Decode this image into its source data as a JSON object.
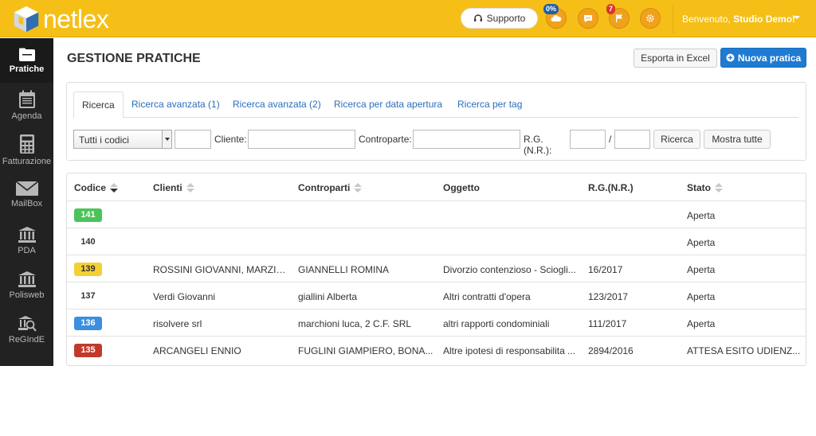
{
  "app": {
    "logo_text": "netlex"
  },
  "header": {
    "support_label": "Supporto",
    "cloud_badge": "0%",
    "notify_badge": "7",
    "welcome_prefix": "Benvenuto, ",
    "welcome_user": "Studio Demo!"
  },
  "sidebar": {
    "items": [
      {
        "label": "Pratiche",
        "icon": "folder-icon"
      },
      {
        "label": "Agenda",
        "icon": "calendar-icon"
      },
      {
        "label": "Fatturazione",
        "icon": "calculator-icon"
      },
      {
        "label": "MailBox",
        "icon": "envelope-icon"
      },
      {
        "label": "PDA",
        "icon": "courthouse-icon"
      },
      {
        "label": "Polisweb",
        "icon": "courthouse-icon"
      },
      {
        "label": "ReGIndE",
        "icon": "registry-icon"
      }
    ]
  },
  "main": {
    "title": "GESTIONE PRATICHE",
    "export_label": "Esporta in Excel",
    "new_label": "Nuova pratica"
  },
  "search": {
    "tabs": [
      "Ricerca",
      "Ricerca avanzata (1)",
      "Ricerca avanzata (2)",
      "Ricerca per data apertura",
      "Ricerca per tag"
    ],
    "select_value": "Tutti i codici",
    "cliente_label": "Cliente:",
    "controparte_label": "Controparte:",
    "rg_label": "R.G.(N.R.):",
    "slash": "/",
    "search_button": "Ricerca",
    "show_all_button": "Mostra tutte"
  },
  "table": {
    "columns": [
      "Codice",
      "Clienti",
      "Controparti",
      "Oggetto",
      "R.G.(N.R.)",
      "Stato"
    ],
    "rows": [
      {
        "code": "141",
        "color": "#4cc35a",
        "clienti": "",
        "controparti": "",
        "oggetto": "",
        "rg": "",
        "stato": "Aperta"
      },
      {
        "code": "140",
        "color": "",
        "clienti": "",
        "controparti": "",
        "oggetto": "",
        "rg": "",
        "stato": "Aperta"
      },
      {
        "code": "139",
        "color": "#f3d033",
        "clienti": "ROSSINI GIOVANNI, MARZIA...",
        "controparti": "GIANNELLI ROMINA",
        "oggetto": "Divorzio contenzioso - Sciogli...",
        "rg": "16/2017",
        "stato": "Aperta"
      },
      {
        "code": "137",
        "color": "",
        "clienti": "Verdi Giovanni",
        "controparti": "giallini Alberta",
        "oggetto": "Altri contratti d'opera",
        "rg": "123/2017",
        "stato": "Aperta"
      },
      {
        "code": "136",
        "color": "#3b8ee0",
        "clienti": "risolvere srl",
        "controparti": "marchioni luca, 2 C.F. SRL",
        "oggetto": "altri rapporti condominiali",
        "rg": "111/2017",
        "stato": "Aperta"
      },
      {
        "code": "135",
        "color": "#c0392b",
        "clienti": "ARCANGELI ENNIO",
        "controparti": "FUGLINI GIAMPIERO, BONA...",
        "oggetto": "Altre ipotesi di responsabilita ...",
        "rg": "2894/2016",
        "stato": "ATTESA ESITO UDIENZ..."
      }
    ]
  },
  "colors": {
    "topbar": "#f5bf17",
    "sidebar": "#222222",
    "primary": "#1f7ad2",
    "link": "#2a6ebc"
  }
}
